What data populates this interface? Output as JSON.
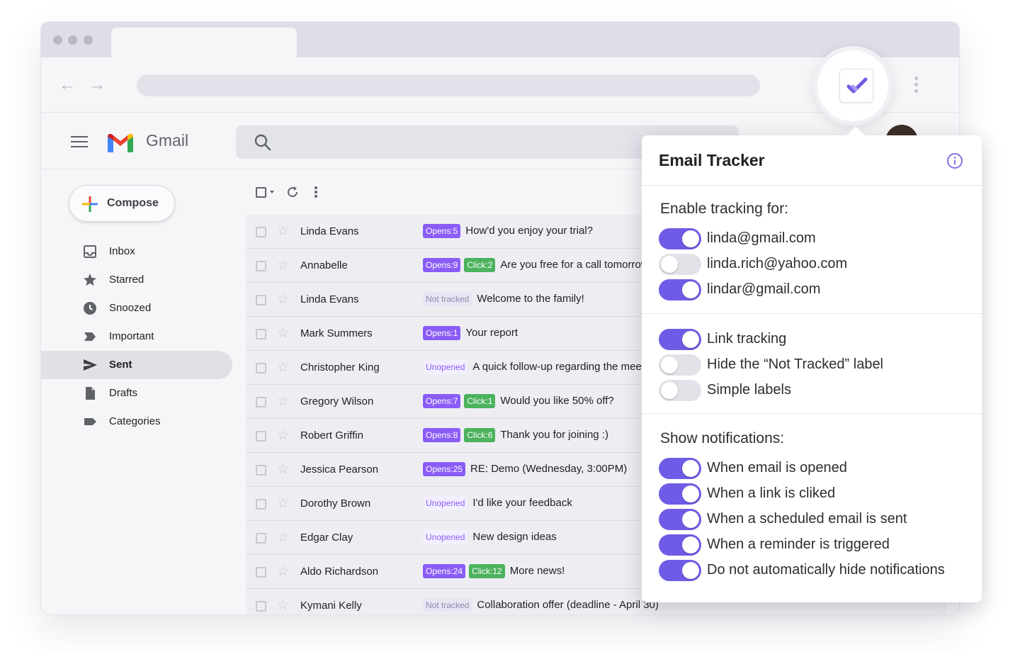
{
  "gmail": {
    "brand": "Gmail",
    "compose_label": "Compose",
    "nav": [
      {
        "label": "Inbox",
        "icon": "inbox-icon",
        "active": false
      },
      {
        "label": "Starred",
        "icon": "star-icon",
        "active": false
      },
      {
        "label": "Snoozed",
        "icon": "clock-icon",
        "active": false
      },
      {
        "label": "Important",
        "icon": "important-icon",
        "active": false
      },
      {
        "label": "Sent",
        "icon": "send-icon",
        "active": true
      },
      {
        "label": "Drafts",
        "icon": "draft-icon",
        "active": false
      },
      {
        "label": "Categories",
        "icon": "label-icon",
        "active": false
      }
    ],
    "emails": [
      {
        "sender": "Linda Evans",
        "tags": [
          {
            "type": "open",
            "text": "Opens:5"
          }
        ],
        "subject": "How'd you enjoy your trial?"
      },
      {
        "sender": "Annabelle",
        "tags": [
          {
            "type": "open",
            "text": "Opens:9"
          },
          {
            "type": "click",
            "text": "Click:2"
          }
        ],
        "subject": "Are you free for a call tomorrow?"
      },
      {
        "sender": "Linda Evans",
        "tags": [
          {
            "type": "not",
            "text": "Not tracked"
          }
        ],
        "subject": "Welcome to the family!"
      },
      {
        "sender": "Mark Summers",
        "tags": [
          {
            "type": "open",
            "text": "Opens:1"
          }
        ],
        "subject": "Your report"
      },
      {
        "sender": "Christopher King",
        "tags": [
          {
            "type": "unop",
            "text": "Unopened"
          }
        ],
        "subject": "A quick follow-up regarding the meeting"
      },
      {
        "sender": "Gregory Wilson",
        "tags": [
          {
            "type": "open",
            "text": "Opens:7"
          },
          {
            "type": "click",
            "text": "Click:1"
          }
        ],
        "subject": "Would you like 50% off?"
      },
      {
        "sender": "Robert Griffin",
        "tags": [
          {
            "type": "open",
            "text": "Opens:8"
          },
          {
            "type": "click",
            "text": "Click:6"
          }
        ],
        "subject": "Thank you for joining :)"
      },
      {
        "sender": "Jessica Pearson",
        "tags": [
          {
            "type": "open",
            "text": "Opens:25"
          }
        ],
        "subject": "RE: Demo (Wednesday, 3:00PM)"
      },
      {
        "sender": "Dorothy Brown",
        "tags": [
          {
            "type": "unop",
            "text": "Unopened"
          }
        ],
        "subject": "I'd like your feedback"
      },
      {
        "sender": "Edgar Clay",
        "tags": [
          {
            "type": "unop",
            "text": "Unopened"
          }
        ],
        "subject": "New design ideas"
      },
      {
        "sender": "Aldo Richardson",
        "tags": [
          {
            "type": "open",
            "text": "Opens:24"
          },
          {
            "type": "click",
            "text": "Click:12"
          }
        ],
        "subject": "More news!"
      },
      {
        "sender": "Kymani Kelly",
        "tags": [
          {
            "type": "not",
            "text": "Not tracked"
          }
        ],
        "subject": "Collaboration offer (deadline - April 30)"
      }
    ]
  },
  "tracker": {
    "title": "Email Tracker",
    "accounts_heading": "Enable tracking for:",
    "accounts": [
      {
        "label": "linda@gmail.com",
        "on": true
      },
      {
        "label": "linda.rich@yahoo.com",
        "on": false
      },
      {
        "label": "lindar@gmail.com",
        "on": true
      }
    ],
    "options": [
      {
        "label": "Link tracking",
        "on": true
      },
      {
        "label": "Hide the “Not Tracked” label",
        "on": false
      },
      {
        "label": "Simple labels",
        "on": false
      }
    ],
    "notifications_heading": "Show notifications:",
    "notifications": [
      {
        "label": "When email is opened",
        "on": true
      },
      {
        "label": "When a link is cliked",
        "on": true
      },
      {
        "label": "When a scheduled email is sent",
        "on": true
      },
      {
        "label": "When a reminder is triggered",
        "on": true
      },
      {
        "label": "Do not automatically hide notifications",
        "on": true
      }
    ]
  },
  "colors": {
    "accent": "#6e5ce6",
    "opens_badge": "#8a5cf6",
    "click_badge": "#4bb25d",
    "toggle_off": "#e2e2e8"
  }
}
